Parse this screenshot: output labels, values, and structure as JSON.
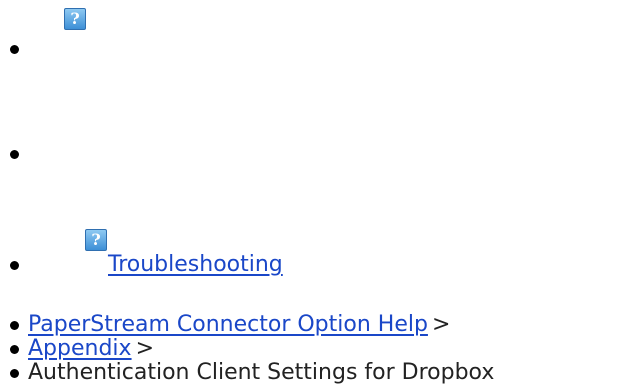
{
  "help_icon_glyph": "?",
  "nav": {
    "troubleshooting_label": "Troubleshooting"
  },
  "breadcrumb": {
    "items": [
      {
        "label": "PaperStream Connector Option Help"
      },
      {
        "label": "Appendix"
      }
    ],
    "separator": ">",
    "current": "Authentication Client Settings for Dropbox"
  }
}
